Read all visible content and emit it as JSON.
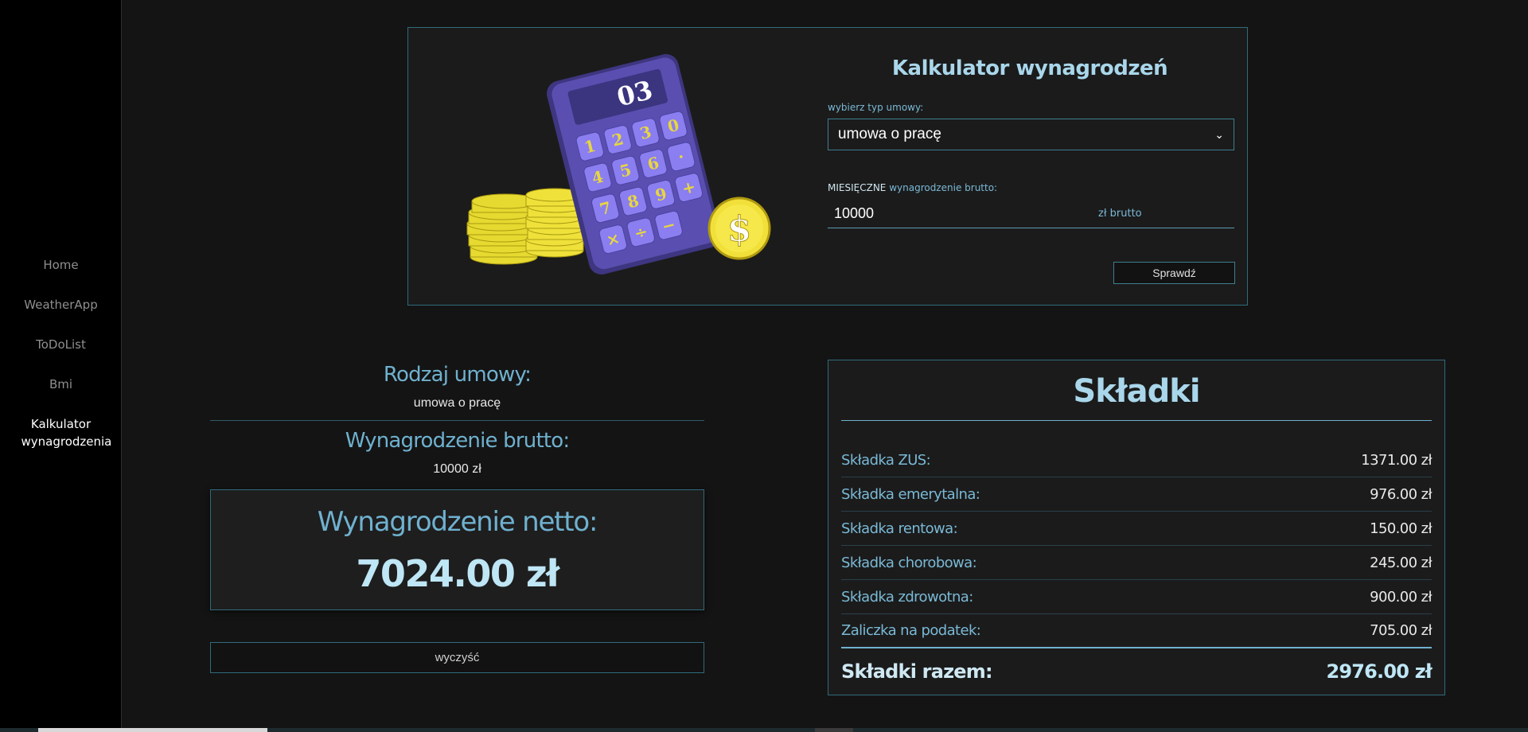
{
  "sidebar": {
    "items": [
      {
        "label": "Home"
      },
      {
        "label": "WeatherApp"
      },
      {
        "label": "ToDoList"
      },
      {
        "label": "Bmi"
      },
      {
        "label": "Kalkulator wynagrodzenia",
        "active": true
      }
    ]
  },
  "calculator": {
    "title": "Kalkulator wynagrodzeń",
    "contract_label": "wybierz typ umowy:",
    "contract_value": "umowa o pracę",
    "salary_label_caps": "MIESIĘCZNE",
    "salary_label_rest": "wynagrodzenie brutto:",
    "salary_value": "10000",
    "salary_unit": "zł brutto",
    "check_button": "Sprawdź",
    "illustration_display": "03",
    "keys": [
      "1",
      "2",
      "3",
      "0",
      "4",
      "5",
      "6",
      "·",
      "7",
      "8",
      "9",
      "+",
      "×",
      "÷",
      "−"
    ]
  },
  "results": {
    "contract_heading": "Rodzaj umowy:",
    "contract_value": "umowa o pracę",
    "brutto_heading": "Wynagrodzenie brutto:",
    "brutto_value": "10000 zł",
    "netto_heading": "Wynagrodzenie netto:",
    "netto_value": "7024.00 zł",
    "clear_button": "wyczyść"
  },
  "skladki": {
    "title": "Składki",
    "rows": [
      {
        "label": "Składka ZUS:",
        "amount": "1371.00 zł"
      },
      {
        "label": "Składka emerytalna:",
        "amount": "976.00 zł"
      },
      {
        "label": "Składka rentowa:",
        "amount": "150.00 zł"
      },
      {
        "label": "Składka chorobowa:",
        "amount": "245.00 zł"
      },
      {
        "label": "Składka zdrowotna:",
        "amount": "900.00 zł"
      },
      {
        "label": "Zaliczka na podatek:",
        "amount": "705.00 zł"
      }
    ],
    "total_label": "Składki razem:",
    "total_amount": "2976.00 zł"
  },
  "colors": {
    "background": "#141414",
    "sidebar": "#000000",
    "accent": "#6fb1cf",
    "border": "#2f6b7a",
    "title": "#a9d6ea"
  }
}
